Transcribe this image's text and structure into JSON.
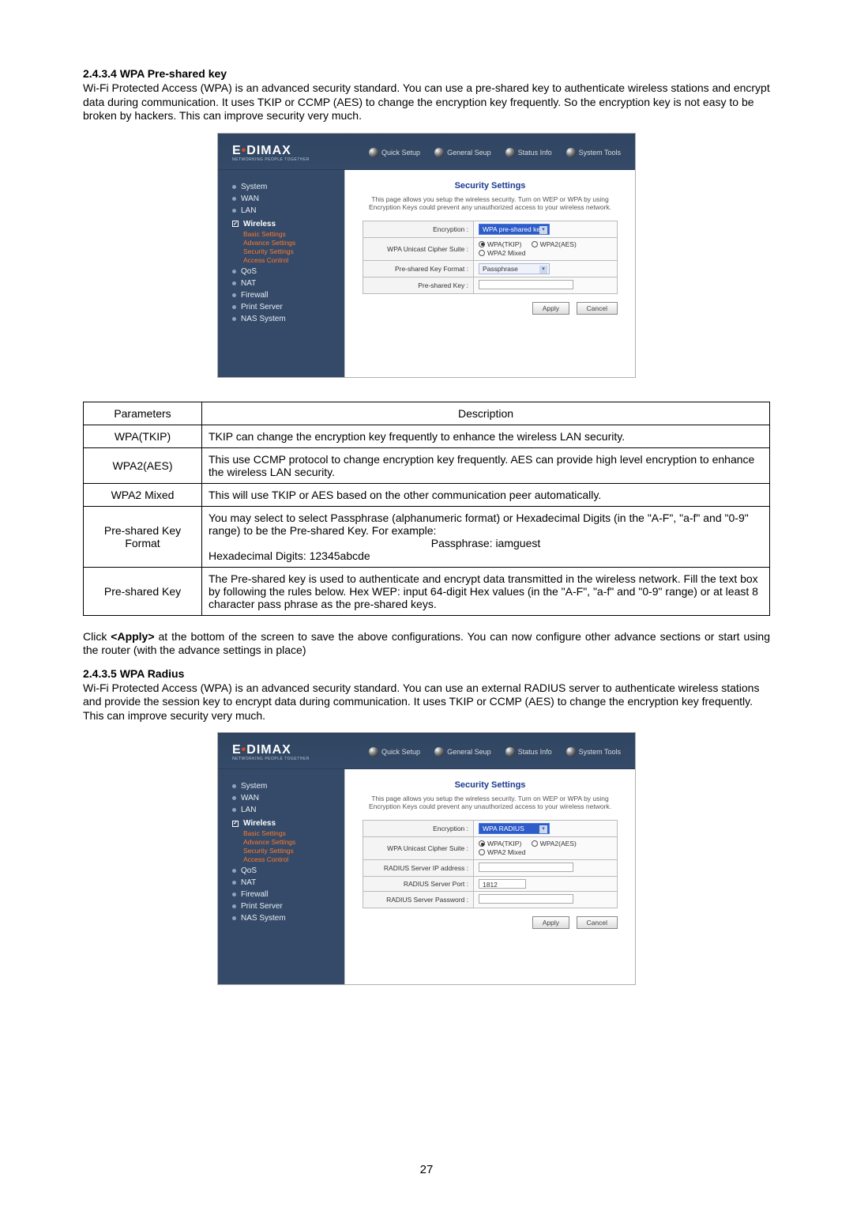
{
  "section1": {
    "heading": "2.4.3.4 WPA Pre-shared key",
    "para": "Wi-Fi Protected Access (WPA) is an advanced security standard. You can use a pre-shared key to authenticate wireless stations and encrypt data during communication. It uses TKIP or CCMP (AES) to change the encryption key frequently. So the encryption key is not easy to be broken by hackers. This can improve security very much."
  },
  "section2": {
    "heading": "2.4.3.5 WPA Radius",
    "para": "Wi-Fi Protected Access (WPA) is an advanced security standard. You can use an external RADIUS server to authenticate wireless stations and provide the session key to encrypt data during communication. It uses TKIP or CCMP (AES) to change the encryption key frequently. This can improve security very much."
  },
  "apply_note": {
    "pre": "Click  ",
    "bold": "<Apply>",
    "post": "  at  the  bottom  of  the  screen  to  save  the  above  configurations.  You  can  now  configure  other  advance sections or start using the router (with the advance settings in place)"
  },
  "page_number": "27",
  "router": {
    "logo_main_pre": "E",
    "logo_main_post": "DIMAX",
    "logo_sub": "NETWORKING PEOPLE TOGETHER",
    "topnav": [
      "Quick Setup",
      "General Seup",
      "Status Info",
      "System Tools"
    ],
    "sidebar": {
      "top": [
        "System",
        "WAN",
        "LAN"
      ],
      "expanded": "Wireless",
      "subs": [
        "Basic Settings",
        "Advance Settings",
        "Security Settings",
        "Access Control"
      ],
      "bottom": [
        "QoS",
        "NAT",
        "Firewall",
        "Print Server",
        "NAS System"
      ]
    },
    "shared": {
      "title": "Security Settings",
      "desc1": "This page allows you setup the wireless security. Turn on WEP or WPA by using",
      "desc2": "Encryption Keys could prevent any unauthorized access to your wireless network.",
      "row_enc": "Encryption :",
      "row_cipher": "WPA Unicast Cipher Suite :",
      "cipher_opts": [
        "WPA(TKIP)",
        "WPA2(AES)",
        "WPA2 Mixed"
      ],
      "apply": "Apply",
      "cancel": "Cancel"
    },
    "psk": {
      "enc_val": "WPA pre-shared key",
      "row_fmt": "Pre-shared Key Format :",
      "fmt_val": "Passphrase",
      "row_key": "Pre-shared Key :"
    },
    "radius": {
      "enc_val": "WPA RADIUS",
      "row_ip": "RADIUS Server IP address :",
      "row_port": "RADIUS Server Port :",
      "port_val": "1812",
      "row_pwd": "RADIUS Server Password :"
    }
  },
  "param_table": {
    "head_params": "Parameters",
    "head_desc": "Description",
    "rows": [
      {
        "p": "WPA(TKIP)",
        "d": "TKIP can change the encryption key frequently to enhance the wireless LAN security."
      },
      {
        "p": "WPA2(AES)",
        "d": "This use CCMP protocol to change encryption key frequently. AES can provide high level encryption to enhance the wireless LAN security."
      },
      {
        "p": "WPA2 Mixed",
        "d": "This will use TKIP or AES based on the other communication peer automatically."
      }
    ],
    "psk_format": {
      "p": "Pre-shared Key Format",
      "l1": "You may select to select Passphrase (alphanumeric format) or Hexadecimal Digits (in the \"A-F\", \"a-f\" and \"0-9\" range) to be the Pre-shared Key. For example:",
      "l2": "Passphrase: iamguest",
      "l3": "Hexadecimal Digits: 12345abcde"
    },
    "psk": {
      "p": "Pre-shared Key",
      "d": "The Pre-shared key is used to authenticate and encrypt data transmitted in the wireless network. Fill the text box by following the rules below.  Hex WEP: input 64-digit Hex values (in the \"A-F\", \"a-f\" and \"0-9\" range) or at least 8 character pass phrase as the pre-shared keys."
    }
  }
}
